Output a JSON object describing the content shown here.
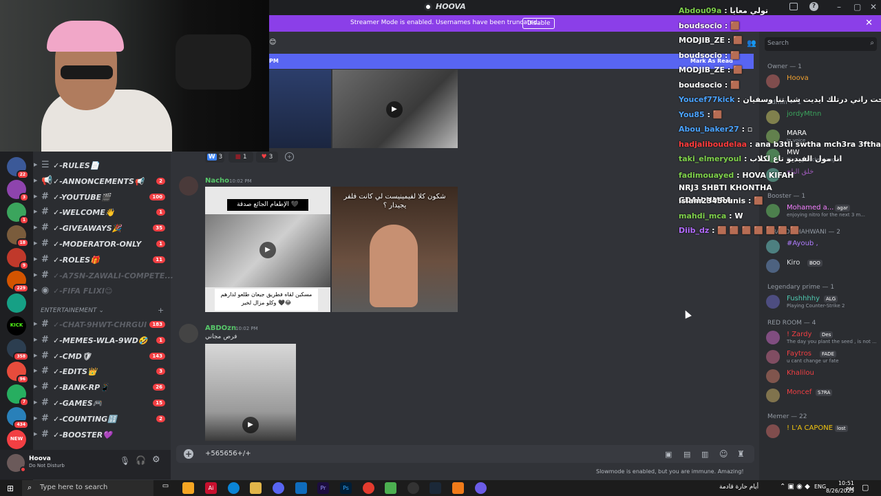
{
  "window": {
    "title": "HOOVA",
    "controls": [
      "–",
      "▢",
      "✕"
    ]
  },
  "banner": {
    "text": "Streamer Mode is enabled. Usernames have been truncated.",
    "button": "Disable"
  },
  "top_bar": {
    "mark_as_read": "Mark As Read",
    "pm_fragment": "PM",
    "search_placeholder": "Search"
  },
  "reactions": [
    {
      "emoji": "W",
      "count": "3"
    },
    {
      "emoji": "■",
      "count": "1"
    },
    {
      "emoji": "♥",
      "count": "3"
    }
  ],
  "servers": [
    {
      "badge": "22"
    },
    {
      "badge": "3"
    },
    {
      "badge": "1"
    },
    {
      "badge": "18"
    },
    {
      "badge": "9"
    },
    {
      "badge": "229"
    },
    {
      "badge": ""
    },
    {
      "label": "KICK",
      "badge": ""
    },
    {
      "badge": "358"
    },
    {
      "badge": "96"
    },
    {
      "badge": "7"
    },
    {
      "badge": "434"
    },
    {
      "label": "NEW",
      "badge": ""
    }
  ],
  "channels": [
    {
      "name": "✓-RULES📄",
      "count": "",
      "icon": "list"
    },
    {
      "name": "✓-ANNONCEMENTS📢",
      "count": "2",
      "icon": "megaphone"
    },
    {
      "name": "✓-YOUTUBE🎬",
      "count": "100",
      "icon": "#"
    },
    {
      "name": "✓-WELCOME👋",
      "count": "1",
      "icon": "#"
    },
    {
      "name": "✓-GIVEAWAYS🎉",
      "count": "35",
      "icon": "#"
    },
    {
      "name": "✓-MODERATOR-ONLY",
      "count": "1",
      "icon": "#"
    },
    {
      "name": "✓-ROLES🎁",
      "count": "11",
      "icon": "#"
    },
    {
      "name": "✓-A7SN-ZAWALI-COMPETE...",
      "count": "",
      "icon": "#",
      "muted": true
    },
    {
      "name": "✓-FIFA FLIXI😊",
      "count": "",
      "icon": "voice",
      "muted": true
    }
  ],
  "category": {
    "label": "ENTERTAINEMENT"
  },
  "channels2": [
    {
      "name": "✓-CHAT-9HWT-CHRGUI",
      "count": "183",
      "muted": true
    },
    {
      "name": "✓-MEMES-WLA-9WD🤣",
      "count": "1"
    },
    {
      "name": "✓-CMD🛡",
      "count": "143"
    },
    {
      "name": "✓-EDITS👑",
      "count": "3"
    },
    {
      "name": "✓-BANK-RP📱",
      "count": "26"
    },
    {
      "name": "✓-GAMES🎮",
      "count": "15"
    },
    {
      "name": "✓-COUNTING🔢",
      "count": "2"
    },
    {
      "name": "✓-BOOSTER💜",
      "count": ""
    }
  ],
  "user": {
    "name": "Hoova",
    "status": "Do Not Disturb"
  },
  "messages": [
    {
      "author": "Nacho",
      "time": "10:02 PM",
      "color": "#57c76a",
      "image_captions": [
        "الإطعام الجائع صدقة 🖤",
        "مسكين لقاه فطريق جيعان طلعو لدارهم وكلو مزال لخير 🖤😂",
        "شكون كلا لفيمينيست لي كانت فلفر يجيدار ؟"
      ]
    },
    {
      "author": "ABDOzn",
      "time": "10:02 PM",
      "color": "#57c76a",
      "text": "فرص مجاني"
    }
  ],
  "composer": {
    "value": "+565656+/+"
  },
  "slowmode": "Slowmode is enabled, but you are immune. Amazing!",
  "chat_overlay": [
    {
      "user": "Abdou09a",
      "msg": "تولي معايا",
      "color": "#7fd14b"
    },
    {
      "user": "boudsocio",
      "msg": "🟫",
      "color": "#ffffff"
    },
    {
      "user": "MODJIB_ZE",
      "msg": "🟫",
      "color": "#ffffff"
    },
    {
      "user": "boudsocio",
      "msg": "🟫",
      "color": "#ffffff"
    },
    {
      "user": "MODJIB_ZE",
      "msg": "🟫",
      "color": "#ffffff"
    },
    {
      "user": "boudsocio",
      "msg": "🟫",
      "color": "#ffffff"
    },
    {
      "user": "Youcef77kick",
      "msg": "هبط لتحت راني درتلك ايديت شبا تنا وسفيان",
      "color": "#4aa3ff"
    },
    {
      "user": "You85",
      "msg": "🟫",
      "color": "#4aa3ff"
    },
    {
      "user": "Abou_baker27",
      "msg": "▫",
      "color": "#4aa3ff"
    },
    {
      "user": "hadjaliboudelaa",
      "msg": "ana b3tli swtha mch3ra 3ftha",
      "color": "#ff3b3b"
    },
    {
      "user": "taki_elmeryoul",
      "msg": "انا مول الفيديو تاع لكلاب",
      "color": "#7fd14b"
    },
    {
      "user": "fadimouayed",
      "msg": "HOVA KIFAH NRJ3 SHBTI KHONTHA GDAH NMRA",
      "color": "#7fd14b"
    },
    {
      "user": "islam2345ounis",
      "msg": "🟫",
      "color": "#ffffff"
    },
    {
      "user": "mahdi_mca",
      "msg": "W",
      "color": "#7fd14b"
    },
    {
      "user": "Diib_dz",
      "msg": "🟫 🟫 🟫 🟫 🟫 🟫 🟫",
      "color": "#b36bff"
    }
  ],
  "member_groups": [
    {
      "label": "Owner — 1",
      "members": [
        {
          "name": "Hoova",
          "color": "#f0a030",
          "status": ""
        }
      ]
    },
    {
      "label": "Admin — 1",
      "members": [
        {
          "name": "jordyMtnn",
          "color": "#3ba55d",
          "status": ""
        },
        {
          "name": "MARA",
          "color": "#ffffff",
          "status": "In voice"
        },
        {
          "name": "MW",
          "color": "#ffffff",
          "status": "Playing Rocket League"
        },
        {
          "name": "خلق الباج",
          "color": "#9b59b6",
          "status": ""
        }
      ]
    },
    {
      "label": "Booster — 1",
      "members": [
        {
          "name": "Mohamed a...",
          "color": "#f47fff",
          "tag": "agar",
          "status": "enjoying nitro for the next 3 m..."
        }
      ]
    },
    {
      "label": "GRAND CHAHWANI — 2",
      "members": [
        {
          "name": "#Ayoub ,",
          "color": "#b07cff",
          "status": ""
        },
        {
          "name": "Kiro",
          "color": "#dbdee1",
          "tag": "BOO",
          "status": ""
        }
      ]
    },
    {
      "label": "Legendary prime — 1",
      "members": [
        {
          "name": "Fushhhhy",
          "color": "#4ec9b0",
          "tag": "ALG",
          "status": "Playing Counter-Strike 2"
        }
      ]
    },
    {
      "label": "RED ROOM — 4",
      "members": [
        {
          "name": "! Zardy",
          "color": "#f23f43",
          "tag": "Des",
          "status": "The day you plant the seed , is not ..."
        },
        {
          "name": "Faytros",
          "color": "#f23f43",
          "tag": "FADE",
          "status": "u cant change ur fate"
        },
        {
          "name": "Khalilou",
          "color": "#f23f43",
          "status": ""
        },
        {
          "name": "Moncef",
          "color": "#f23f43",
          "tag": "S7RA",
          "status": ""
        }
      ]
    },
    {
      "label": "Memer — 22",
      "members": [
        {
          "name": "! L'A CAPONE",
          "color": "#f1c40f",
          "tag": "lost",
          "status": ""
        }
      ]
    }
  ],
  "taskbar": {
    "search_placeholder": "Type here to search",
    "lang": "ENG",
    "time": "10:51 PM",
    "date": "8/26/2025",
    "weather": "أيام حارة قادمة"
  },
  "colors": {
    "accent": "#5865f2",
    "banner": "#8b3fe8",
    "mention": "#f23f43"
  }
}
